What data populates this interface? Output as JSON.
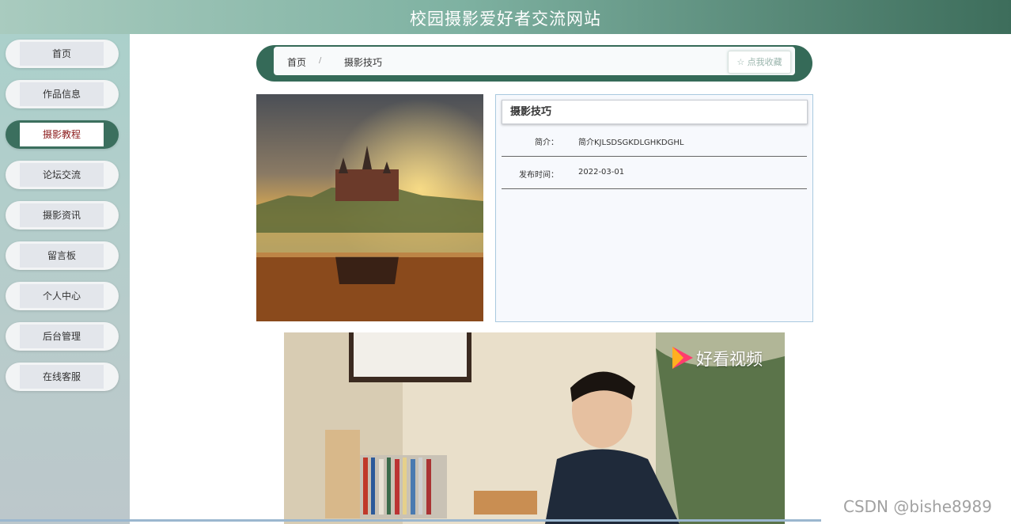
{
  "header": {
    "title": "校园摄影爱好者交流网站"
  },
  "sidebar": {
    "items": [
      {
        "label": "首页",
        "active": false
      },
      {
        "label": "作品信息",
        "active": false
      },
      {
        "label": "摄影教程",
        "active": true
      },
      {
        "label": "论坛交流",
        "active": false
      },
      {
        "label": "摄影资讯",
        "active": false
      },
      {
        "label": "留言板",
        "active": false
      },
      {
        "label": "个人中心",
        "active": false
      },
      {
        "label": "后台管理",
        "active": false
      },
      {
        "label": "在线客服",
        "active": false
      }
    ]
  },
  "breadcrumb": {
    "home": "首页",
    "separator": "/",
    "current": "摄影技巧",
    "favorite_label": "☆ 点我收藏"
  },
  "detail": {
    "title": "摄影技巧",
    "intro_label": "简介：",
    "intro_value": "简介KJLSDSGKDLGHKDGHL",
    "date_label": "发布时间：",
    "date_value": "2022-03-01"
  },
  "video": {
    "brand": "好看视频"
  },
  "watermark": "CSDN @bishe8989",
  "colors": {
    "accent": "#356a58",
    "active_text": "#8b1a1a"
  }
}
